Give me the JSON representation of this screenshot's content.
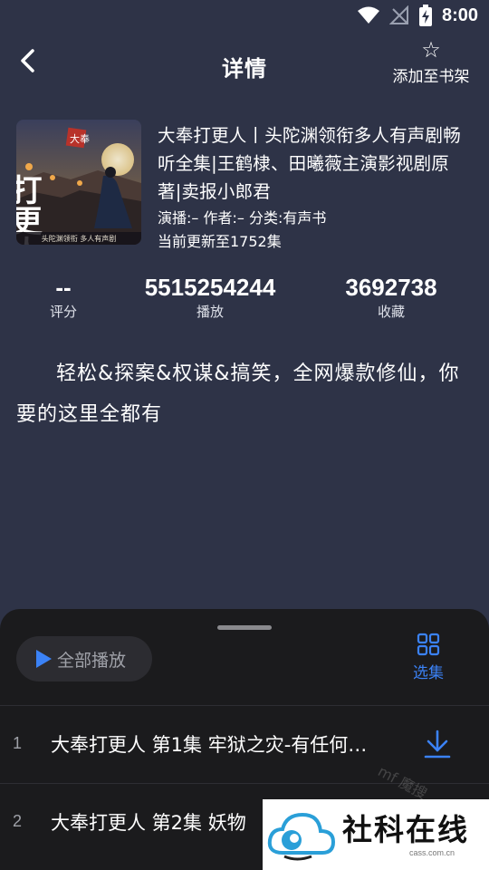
{
  "status_bar": {
    "time": "8:00"
  },
  "header": {
    "title": "详情",
    "shelf_label": "添加至书架"
  },
  "book": {
    "title": "大奉打更人丨头陀渊领衔多人有声剧畅听全集|王鹤棣、田曦薇主演影视剧原著|卖报小郎君",
    "credits": "演播:–  作者:–  分类:有声书",
    "update": "当前更新至1752集",
    "cover": {
      "brand_text": "大奉",
      "title_text": "打更人",
      "footer_text": "头陀渊领衔  多人有声剧"
    }
  },
  "stats": [
    {
      "value": "--",
      "label": "评分"
    },
    {
      "value": "5515254244",
      "label": "播放"
    },
    {
      "value": "3692738",
      "label": "收藏"
    }
  ],
  "description": "轻松&探案&权谋&搞笑，全网爆款修仙，你要的这里全都有",
  "playlist": {
    "play_all_label": "全部播放",
    "select_label": "选集",
    "episodes": [
      {
        "index": "1",
        "title": "大奉打更人 第1集 牢狱之灾-有任何…"
      },
      {
        "index": "2",
        "title": "大奉打更人 第2集 妖物"
      }
    ]
  },
  "watermark": {
    "text": "社科在线",
    "sub": "cass.com.cn",
    "faint": "mf 魔搜"
  },
  "colors": {
    "background": "#2e3347",
    "sheet": "#1b1b1d",
    "accent": "#3b82f6"
  }
}
